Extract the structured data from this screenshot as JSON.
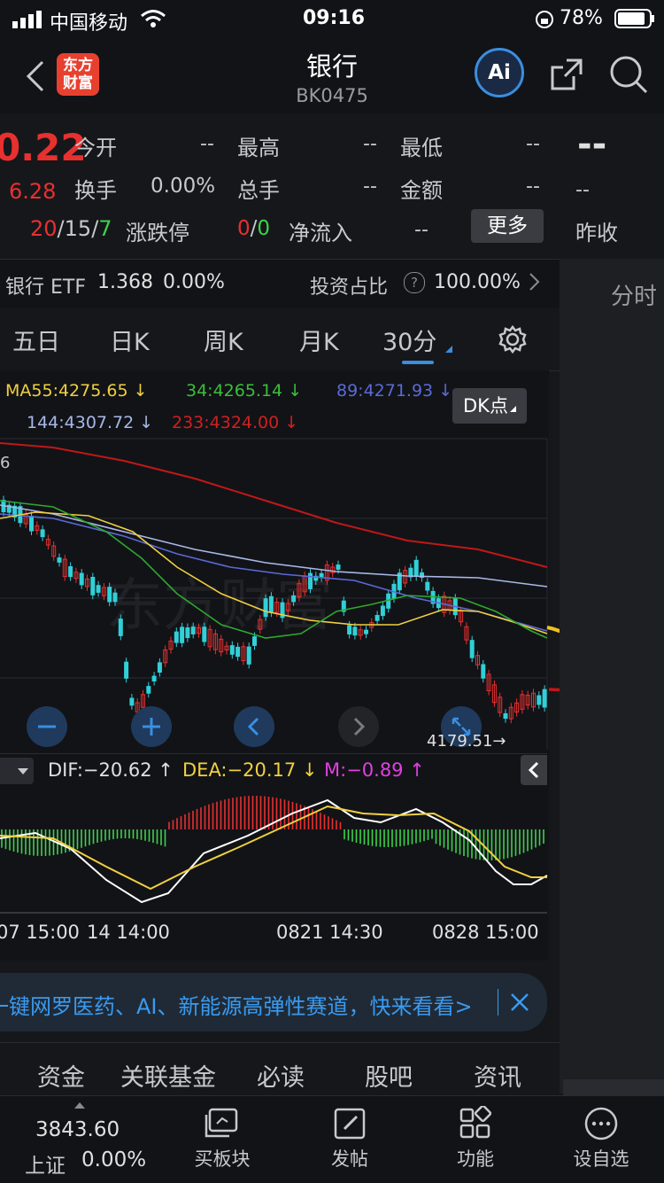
{
  "status_bar": {
    "carrier": "中国移动",
    "time": "09:16",
    "battery": "78%"
  },
  "nav": {
    "title": "银行",
    "code": "BK0475",
    "logo": "东方财富",
    "ai_label": "Ai"
  },
  "quote": {
    "price": "0.22",
    "change": "6.28",
    "rise": "20",
    "flat": "15",
    "fall": "7",
    "open_label": "今开",
    "open_value": "--",
    "high_label": "最高",
    "high_value": "--",
    "low_label": "最低",
    "low_value": "--",
    "turnover_label": "换手",
    "turnover_value": "0.00%",
    "volume_label": "总手",
    "volume_value": "--",
    "amount_label": "金额",
    "amount_value": "--",
    "limit_label": "涨跌停",
    "limit_up": "0",
    "limit_down": "0",
    "netflow_label": "净流入",
    "netflow_value": "--",
    "more_label": "更多",
    "prev_close_dash": "--",
    "prev_close_dash2": "--",
    "prev_close_label": "昨收"
  },
  "etf": {
    "name": "银行 ETF",
    "price": "1.368",
    "pct": "0.00%",
    "ratio_label": "投资占比",
    "ratio_value": "100.00%"
  },
  "right_tab": "分时",
  "tabs": [
    "五日",
    "日K",
    "周K",
    "月K",
    "30分"
  ],
  "ma": {
    "ma55": "MA55:4275.65 ↓",
    "ma34": "34:4265.14 ↓",
    "ma89": "89:4271.93 ↓",
    "ma144": "144:4307.72 ↓",
    "ma233": "233:4324.00 ↓"
  },
  "dk_label": "DK点",
  "chart": {
    "low_marker": "4179.51→",
    "axis_stub": "6"
  },
  "macd": {
    "dif": "DIF:−20.62 ↑",
    "dea": "DEA:−20.17 ↓",
    "m": "M:−0.89 ↑"
  },
  "time_axis": [
    "07 15:00",
    "14 14:00",
    "0821 14:30",
    "0828 15:00"
  ],
  "banner": {
    "text": "一键网罗医药、AI、新能源高弹性赛道，快来看看>"
  },
  "bottom_tabs": [
    "资金",
    "关联基金",
    "必读",
    "股吧",
    "资讯"
  ],
  "dock": {
    "index_value": "3843.60",
    "index_name": "上证",
    "index_pct": "0.00%",
    "items": [
      "买板块",
      "发帖",
      "功能",
      "设自选"
    ]
  },
  "colors": {
    "rise": "#e8302f",
    "fall": "#3bd34a",
    "accent": "#3a8ee0",
    "ma55": "#f0d040",
    "ma34": "#3bbf3b",
    "ma89": "#5a6ad8",
    "ma144": "#a8b8e8",
    "ma233": "#d02020"
  }
}
